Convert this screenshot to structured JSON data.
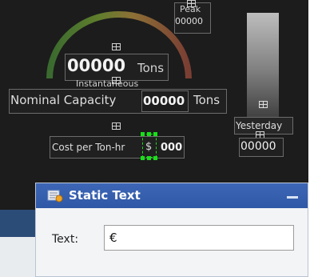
{
  "dashboard": {
    "gauge": {
      "value": "00000",
      "unit": "Tons",
      "caption": "Instantaneous"
    },
    "peak": {
      "label": "Peak",
      "value": "00000"
    },
    "nominal_capacity": {
      "label": "Nominal Capacity",
      "value": "00000",
      "unit": "Tons"
    },
    "cost": {
      "label": "Cost per Ton-hr",
      "currency": "$",
      "value": "000"
    },
    "yesterday": {
      "label": "Yesterday",
      "value": "00000"
    }
  },
  "properties_panel": {
    "title": "Static Text",
    "text_label": "Text:",
    "text_value": "€"
  },
  "colors": {
    "canvas_background": "#1c1c1c",
    "panel_header": "#3561ae",
    "selection_handle": "#18e018"
  },
  "icons": {
    "move_handle": "move-handle-icon",
    "panel_icon": "static-text-icon",
    "minimize": "minimize-icon"
  }
}
